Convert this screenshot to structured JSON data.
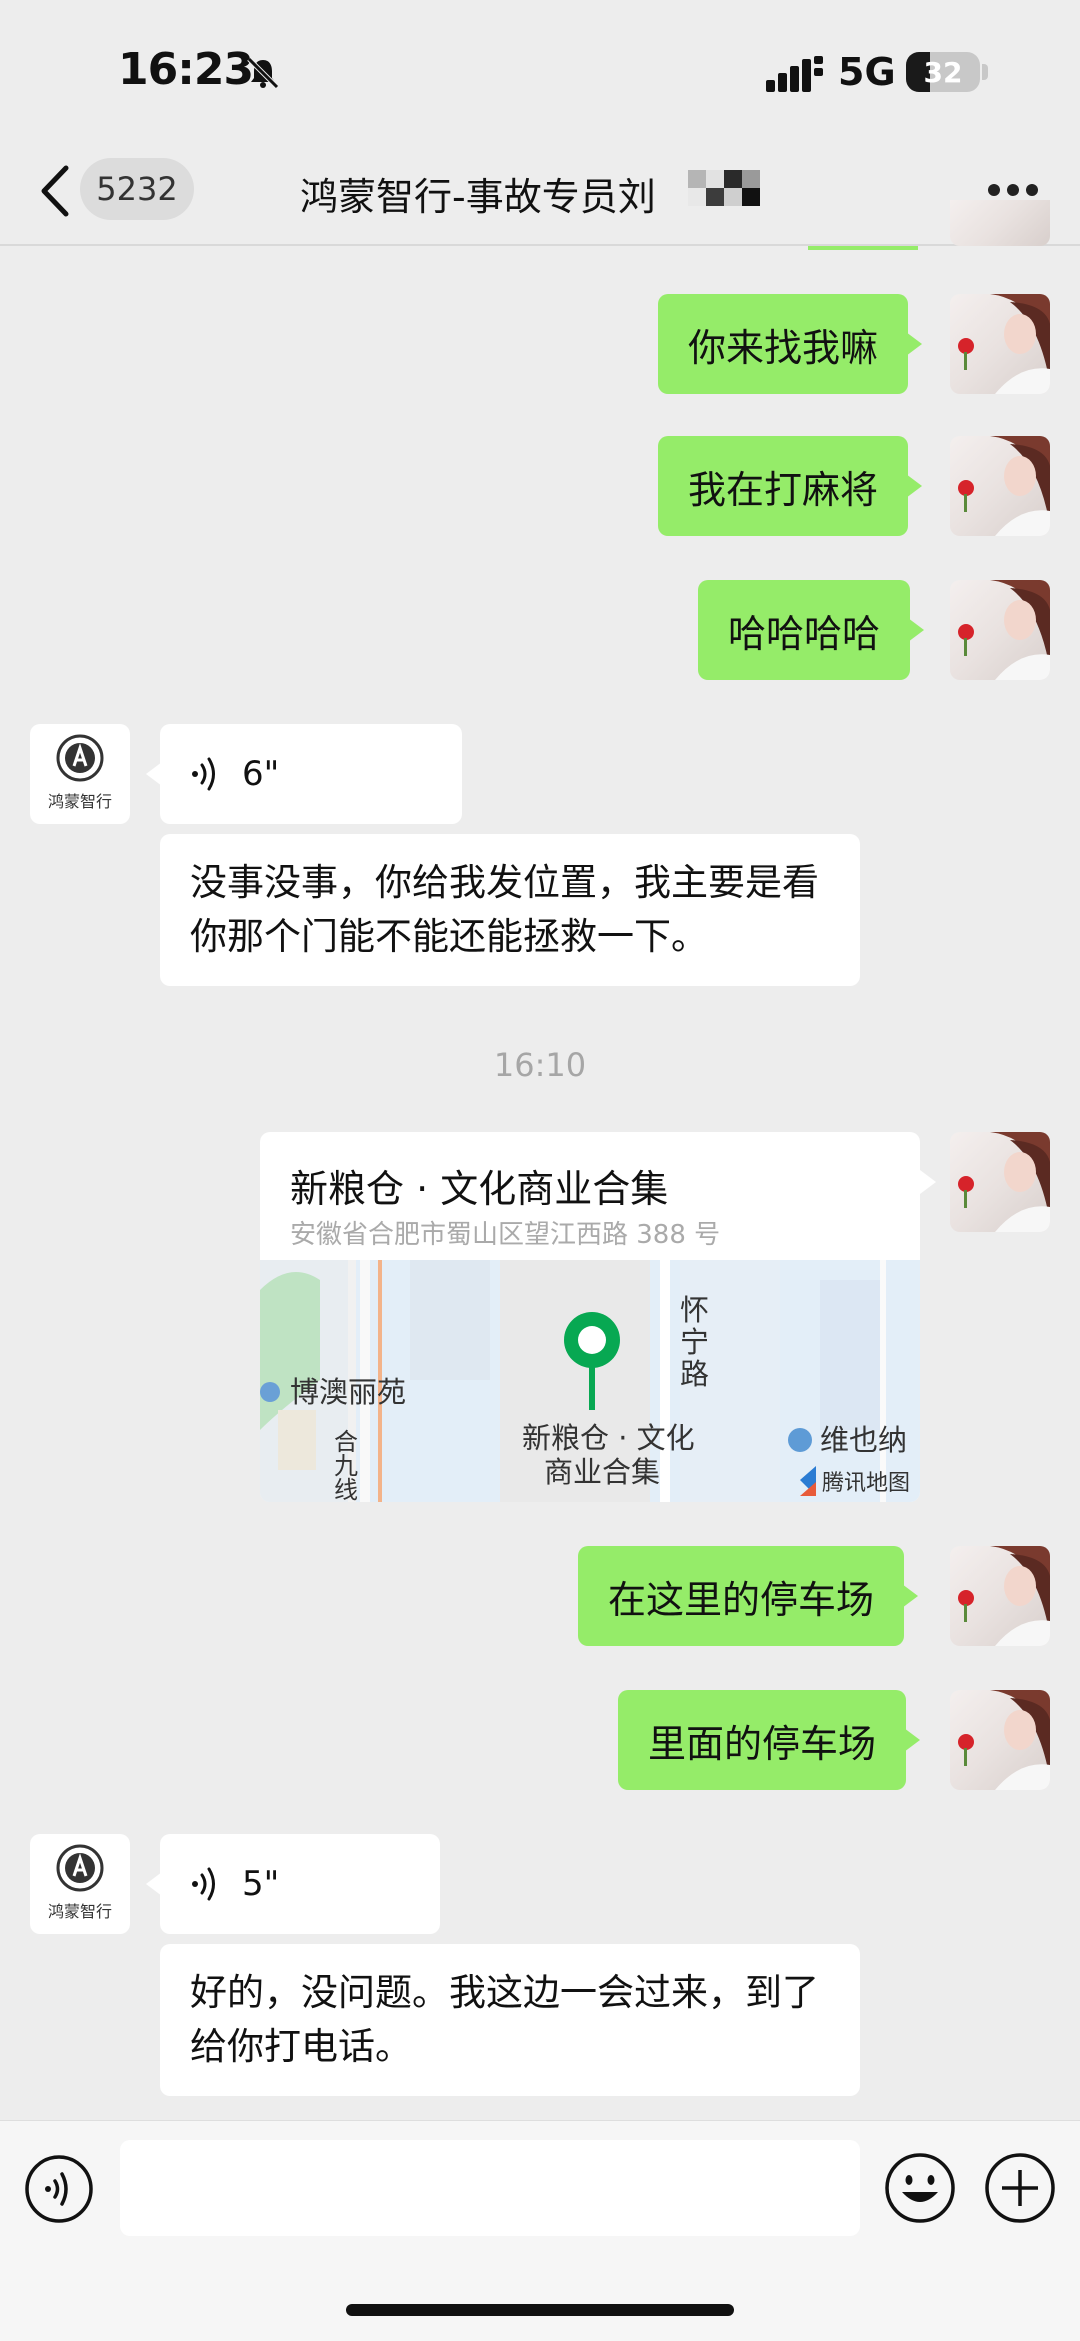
{
  "status_bar": {
    "time": "16:23",
    "network": "5G",
    "battery": "32",
    "battery_level": 0.32
  },
  "nav": {
    "unread_count": "5232",
    "title": "鸿蒙智行-事故专员刘"
  },
  "contact_avatar": {
    "line1": "鸿蒙智行"
  },
  "messages": [
    {
      "side": "me",
      "text": "你来找我嘛"
    },
    {
      "side": "me",
      "text": "我在打麻将"
    },
    {
      "side": "me",
      "text": "哈哈哈哈"
    },
    {
      "side": "them",
      "voice_duration": "6\""
    },
    {
      "side": "them",
      "text": "没事没事，你给我发位置，我主要是看你那个门能不能还能拯救一下。"
    },
    {
      "side": "me",
      "location": {
        "title": "新粮仓 · 文化商业合集",
        "address": "安徽省合肥市蜀山区望江西路 388 号",
        "map_labels": [
          "博澳丽苑",
          "怀宁路",
          "合九线",
          "新粮仓 · 文化商业合集",
          "维也纳",
          "腾讯地图"
        ]
      }
    },
    {
      "side": "me",
      "text": "在这里的停车场"
    },
    {
      "side": "me",
      "text": "里面的停车场"
    },
    {
      "side": "them",
      "voice_duration": "5\""
    },
    {
      "side": "them",
      "text": "好的，没问题。我这边一会过来，到了给你打电话。"
    }
  ],
  "time_separator": "16:10",
  "colors": {
    "green_bubble": "#95ec69",
    "background": "#ededed",
    "map_pin": "#07a852"
  },
  "icons": [
    "bell-mute-icon",
    "signal-icon",
    "chevron-left-icon",
    "more-icon",
    "voice-wave-icon",
    "map-pin-icon",
    "voice-input-icon",
    "emoji-icon",
    "plus-icon"
  ]
}
